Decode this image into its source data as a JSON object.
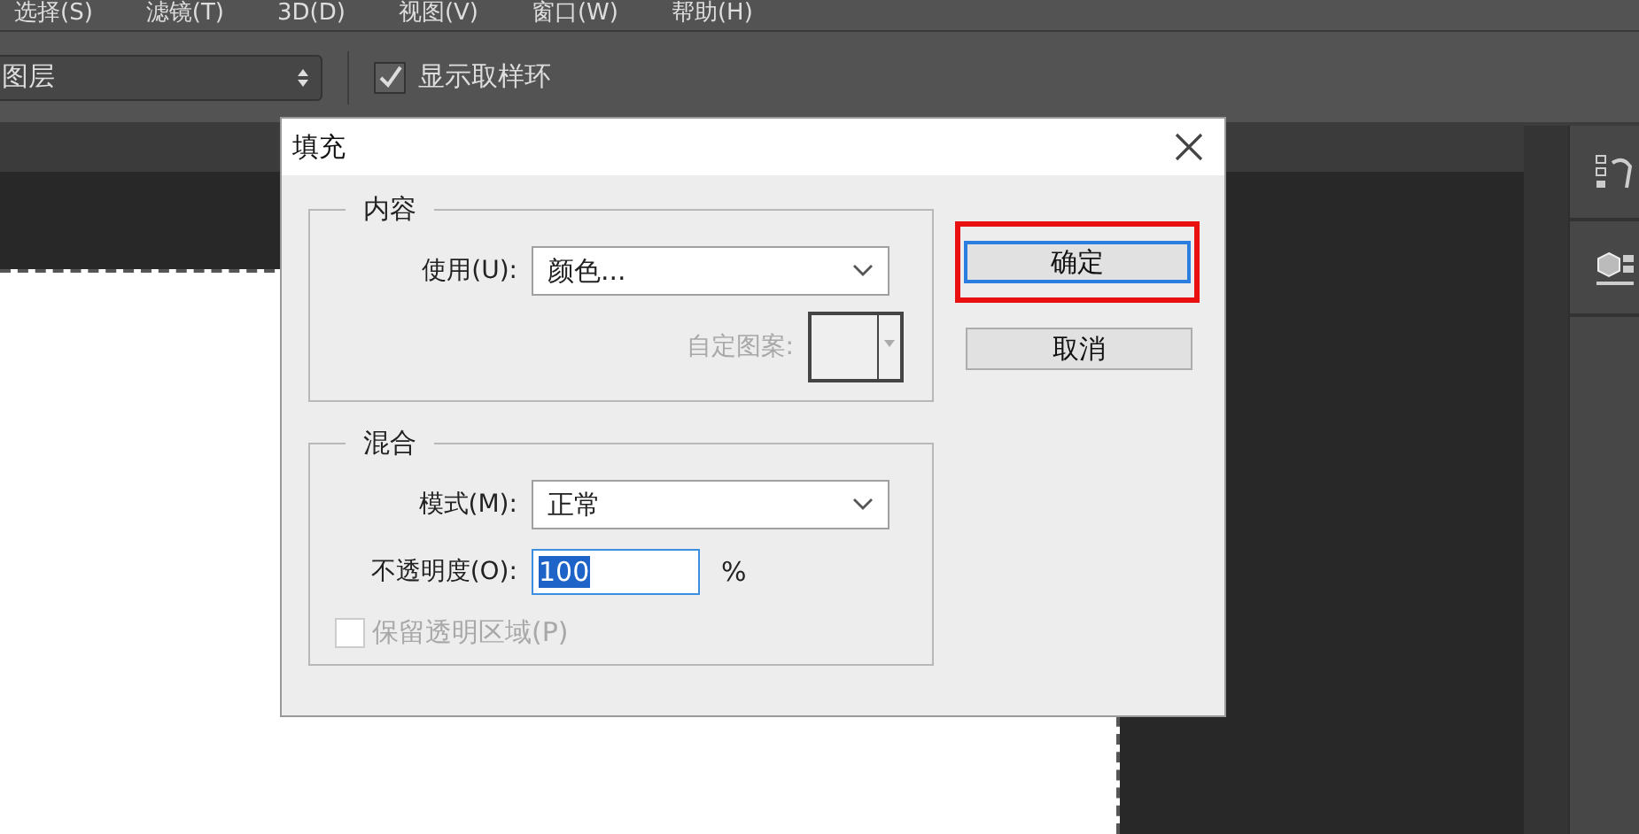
{
  "menu": [
    "选择(S)",
    "滤镜(T)",
    "3D(D)",
    "视图(V)",
    "窗口(W)",
    "帮助(H)"
  ],
  "toolbar": {
    "sample_select": "图层",
    "show_sampling_ring": {
      "label": "显示取样环",
      "checked": true
    }
  },
  "dialog": {
    "title": "填充",
    "content": {
      "legend": "内容",
      "use_label": "使用(U):",
      "use_value": "颜色...",
      "pattern_label": "自定图案:",
      "pattern_disabled": true
    },
    "blend": {
      "legend": "混合",
      "mode_label": "模式(M):",
      "mode_value": "正常",
      "opacity_label": "不透明度(O):",
      "opacity_value": "100",
      "opacity_unit": "%",
      "preserve": {
        "label": "保留透明区域(P)",
        "checked": false,
        "disabled": true
      }
    },
    "buttons": [
      {
        "label": "确定",
        "default": true,
        "highlighted": true
      },
      {
        "label": "取消",
        "default": false,
        "highlighted": false
      }
    ]
  }
}
